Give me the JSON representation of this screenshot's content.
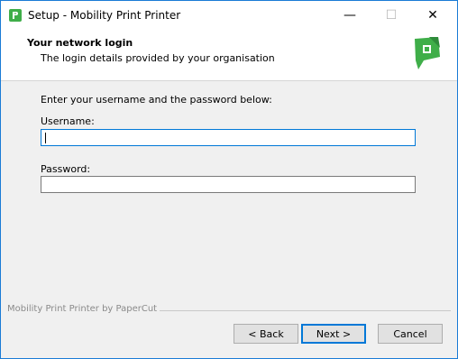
{
  "window": {
    "title": "Setup - Mobility Print Printer",
    "icon": "papercut-p-icon",
    "controls": {
      "minimize": "—",
      "maximize": "☐",
      "close": "✕"
    }
  },
  "header": {
    "title": "Your network login",
    "subtitle": "The login details provided by your organisation",
    "logo": "papercut-logo-icon"
  },
  "form": {
    "instructions": "Enter your username and the password below:",
    "username_label": "Username:",
    "username_value": "",
    "password_label": "Password:",
    "password_value": ""
  },
  "footer": {
    "brand": "Mobility Print Printer by PaperCut",
    "back_label": "< Back",
    "next_label": "Next >",
    "cancel_label": "Cancel"
  },
  "colors": {
    "accent": "#0078d7",
    "brand_green": "#3fae49"
  }
}
